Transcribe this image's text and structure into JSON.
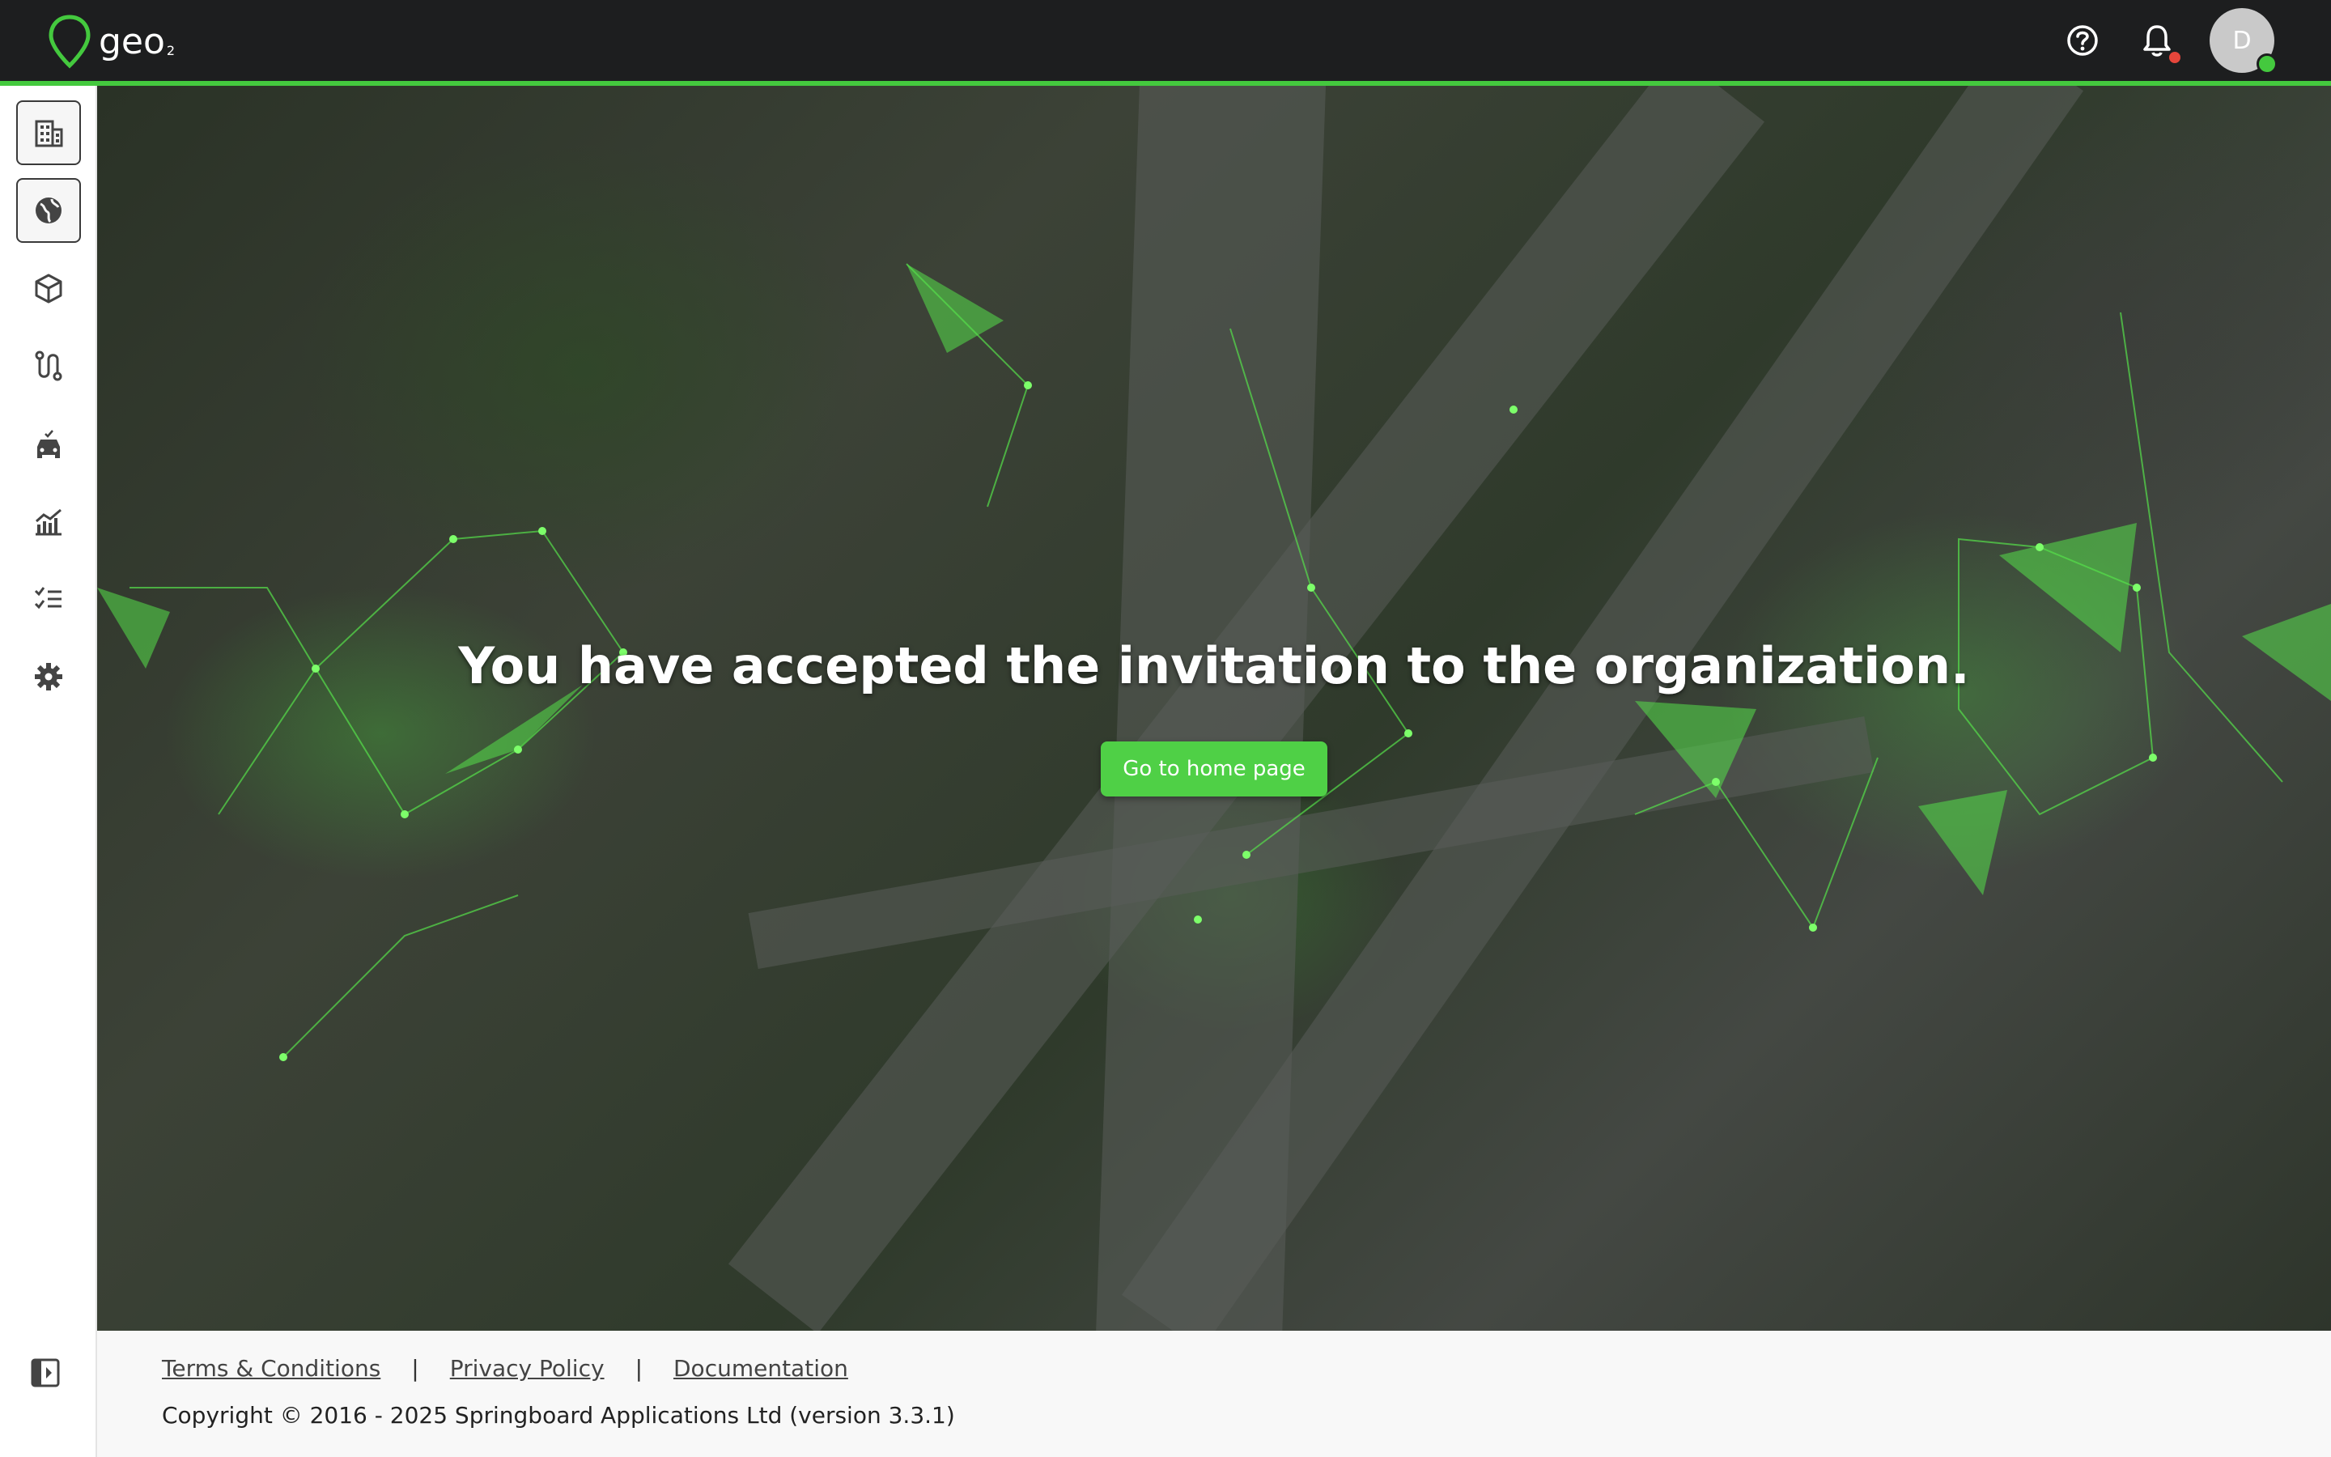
{
  "header": {
    "logo_text": "geo",
    "logo_sub": "2",
    "help_icon": "help-circle-icon",
    "notifications_icon": "bell-icon",
    "avatar_initial": "D"
  },
  "sidebar": {
    "items": [
      {
        "name": "organization",
        "icon": "building-icon",
        "active": false
      },
      {
        "name": "globe",
        "icon": "globe-icon",
        "active": true
      },
      {
        "name": "packages",
        "icon": "box-icon",
        "active": false
      },
      {
        "name": "routes",
        "icon": "route-icon",
        "active": false
      },
      {
        "name": "vehicles",
        "icon": "car-icon",
        "active": false
      },
      {
        "name": "analytics",
        "icon": "chart-icon",
        "active": false
      },
      {
        "name": "tasks",
        "icon": "checklist-icon",
        "active": false
      },
      {
        "name": "settings",
        "icon": "gear-icon",
        "active": false
      }
    ],
    "collapse_icon": "sidebar-collapse-icon"
  },
  "main": {
    "title": "You have accepted the invitation to the organization.",
    "home_button_label": "Go to home page"
  },
  "footer": {
    "links": [
      "Terms & Conditions",
      "Privacy Policy",
      "Documentation"
    ],
    "separator": "|",
    "copyright": "Copyright © 2016 - 2025 Springboard Applications Ltd (version 3.3.1)"
  },
  "colors": {
    "topbar": "#1d1e1f",
    "accent": "#44c93e",
    "button": "#4fd046",
    "notification": "#e6463b"
  }
}
